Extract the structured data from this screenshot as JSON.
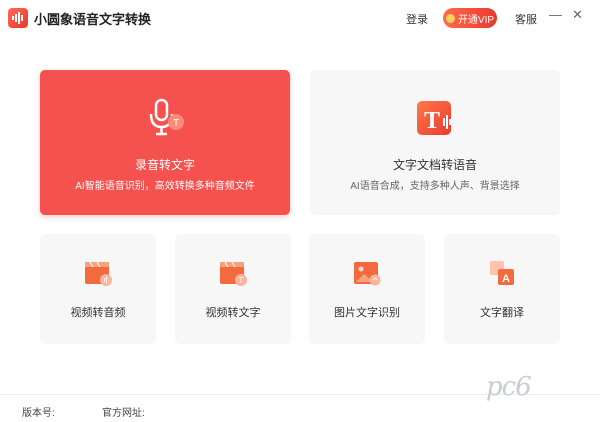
{
  "window": {
    "title": "小圆象语音文字转换",
    "login": "登录",
    "vip_button": "开通VIP",
    "service": "客服",
    "minimize": "—",
    "close": "✕"
  },
  "cards": {
    "record_to_text": {
      "title": "录音转文字",
      "subtitle": "AI智能语音识别，高效转换多种音频文件"
    },
    "text_to_speech": {
      "title": "文字文档转语音",
      "subtitle": "AI语音合成，支持多种人声、背景选择"
    },
    "video_to_audio": {
      "label": "视频转音频"
    },
    "video_to_text": {
      "label": "视频转文字"
    },
    "image_ocr": {
      "label": "图片文字识别"
    },
    "text_translate": {
      "label": "文字翻译"
    }
  },
  "footer": {
    "version_label": "版本号:",
    "website_label": "官方网址:"
  },
  "watermark": "pc6",
  "colors": {
    "accent": "#f5514f",
    "card_bg": "#f7f7f7"
  }
}
